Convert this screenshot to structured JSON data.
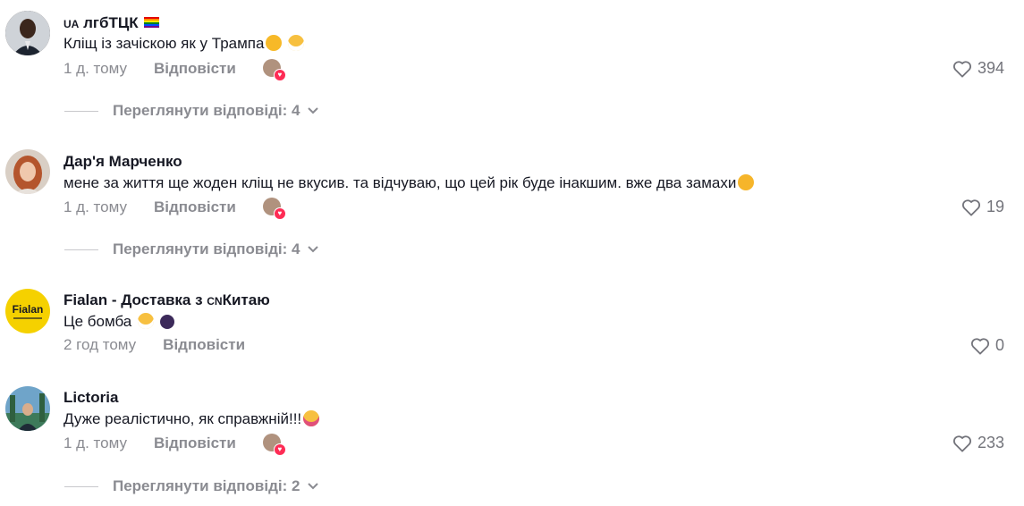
{
  "comments": [
    {
      "user_prefix": "UA",
      "username": "лгбТЦК",
      "text": "Кліщ із зачіскою як у Трампа",
      "time": "1 д. тому",
      "reply_label": "Відповісти",
      "likes": "394",
      "view_replies": "Переглянути відповіді: 4"
    },
    {
      "username": "Дар'я Марченко",
      "text": "мене за життя ще жоден кліщ не вкусив. та відчуваю, що цей рік буде інакшим. вже два замахи",
      "time": "1 д. тому",
      "reply_label": "Відповісти",
      "likes": "19",
      "view_replies": "Переглянути відповіді: 4"
    },
    {
      "username_a": "Fialan - Доставка з ",
      "username_flag": "CN",
      "username_b": "Китаю",
      "avatar_text": "Fialan",
      "text": "Це бомба",
      "time": "2 год тому",
      "reply_label": "Відповісти",
      "likes": "0"
    },
    {
      "username": "Lictoria",
      "text": "Дуже реалістично, як справжній!!!",
      "time": "1 д. тому",
      "reply_label": "Відповісти",
      "likes": "233",
      "view_replies": "Переглянути відповіді: 2"
    }
  ],
  "colors": {
    "accent_heart": "#fe2c55",
    "muted": "#8a8b91",
    "text": "#161823",
    "fialan_yellow": "#f5d100"
  }
}
